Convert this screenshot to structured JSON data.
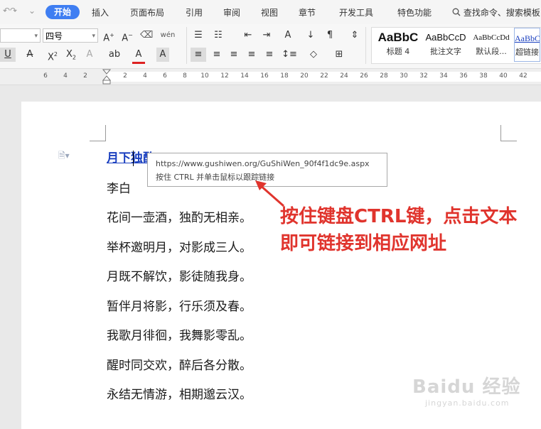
{
  "menubar": {
    "tabs": [
      "开始",
      "插入",
      "页面布局",
      "引用",
      "审阅",
      "视图",
      "章节",
      "开发工具",
      "特色功能"
    ],
    "search_label": "查找命令、搜索模板"
  },
  "ribbon": {
    "font_size": "四号",
    "styles": [
      {
        "preview": "AaBbC",
        "name": "标题 4"
      },
      {
        "preview": "AaBbCcD",
        "name": "批注文字"
      },
      {
        "preview": "AaBbCcDd",
        "name": "默认段..."
      },
      {
        "preview": "AaBbC",
        "name": "超链接"
      }
    ]
  },
  "ruler": {
    "left_numbers": [
      "6",
      "4",
      "2",
      "2"
    ],
    "right_numbers": [
      "2",
      "4",
      "6",
      "8",
      "10",
      "12",
      "14",
      "16",
      "18",
      "20",
      "22",
      "24",
      "26",
      "28",
      "30",
      "32",
      "34",
      "36",
      "38",
      "40",
      "42"
    ]
  },
  "document": {
    "title": "月下独酌",
    "author": "李白",
    "lines": [
      "花间一壶酒，独酌无相亲。",
      "举杯邀明月，对影成三人。",
      "月既不解饮，影徒随我身。",
      "暂伴月将影，行乐须及春。",
      "我歌月徘徊，我舞影零乱。",
      "醒时同交欢，醉后各分散。",
      "永结无情游，相期邈云汉。"
    ]
  },
  "tooltip": {
    "url": "https://www.gushiwen.org/GuShiWen_90f4f1dc9e.aspx",
    "hint": "按住 CTRL 并单击鼠标以跟踪链接"
  },
  "callout": {
    "line1": "按住键盘CTRL键，点击文本",
    "line2": "即可链接到相应网址",
    "color": "#e0342d"
  },
  "watermark": {
    "main": "Baidu 经验",
    "sub": "jingyan.baidu.com"
  },
  "colors": {
    "active_tab": "#3f7ef2",
    "link": "#1a3fbf"
  }
}
